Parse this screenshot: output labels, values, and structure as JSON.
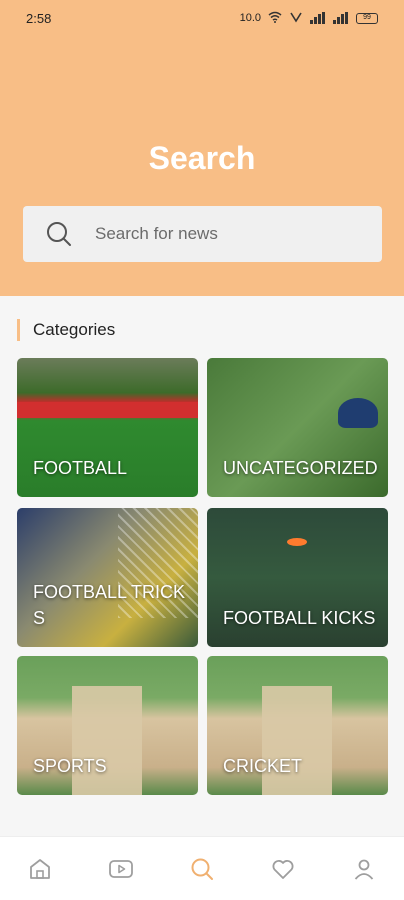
{
  "status_bar": {
    "time": "2:58",
    "net_speed": "10.0",
    "battery": "99"
  },
  "header": {
    "title": "Search",
    "background_color": "#f8be86"
  },
  "search": {
    "placeholder": "Search for news",
    "icon": "search-icon"
  },
  "categories": {
    "title": "Categories",
    "items": [
      {
        "label": "FOOTBALL"
      },
      {
        "label": "UNCATEGORIZED"
      },
      {
        "label": "FOOTBALL TRICKS"
      },
      {
        "label": "FOOTBALL KICKS"
      },
      {
        "label": "SPORTS"
      },
      {
        "label": "CRICKET"
      }
    ]
  },
  "bottom_nav": {
    "items": [
      {
        "icon": "home-icon"
      },
      {
        "icon": "video-icon"
      },
      {
        "icon": "search-icon",
        "active": true
      },
      {
        "icon": "heart-icon"
      },
      {
        "icon": "profile-icon"
      }
    ],
    "active_color": "#f0b070",
    "inactive_color": "#9e9e9e"
  }
}
